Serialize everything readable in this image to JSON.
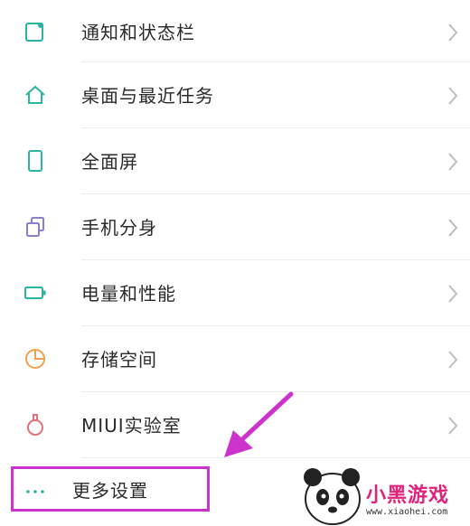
{
  "settings": {
    "items": [
      {
        "label": "通知和状态栏",
        "icon": "notification-icon"
      },
      {
        "label": "桌面与最近任务",
        "icon": "home-icon"
      },
      {
        "label": "全面屏",
        "icon": "phone-icon"
      },
      {
        "label": "手机分身",
        "icon": "dual-icon"
      },
      {
        "label": "电量和性能",
        "icon": "battery-icon"
      },
      {
        "label": "存储空间",
        "icon": "storage-icon"
      },
      {
        "label": "MIUI实验室",
        "icon": "lab-icon"
      }
    ],
    "more": {
      "label": "更多设置",
      "icon": "more-dots-icon"
    }
  },
  "watermark": {
    "brand": "小黑游戏",
    "url": "www.xiaohei.com"
  },
  "colors": {
    "icon_teal": "#2bb5a0",
    "icon_storage": "#f0a04a",
    "icon_lab": "#e0707a",
    "icon_dual": "#8a7fc9",
    "annotation": "#cc33cc"
  }
}
